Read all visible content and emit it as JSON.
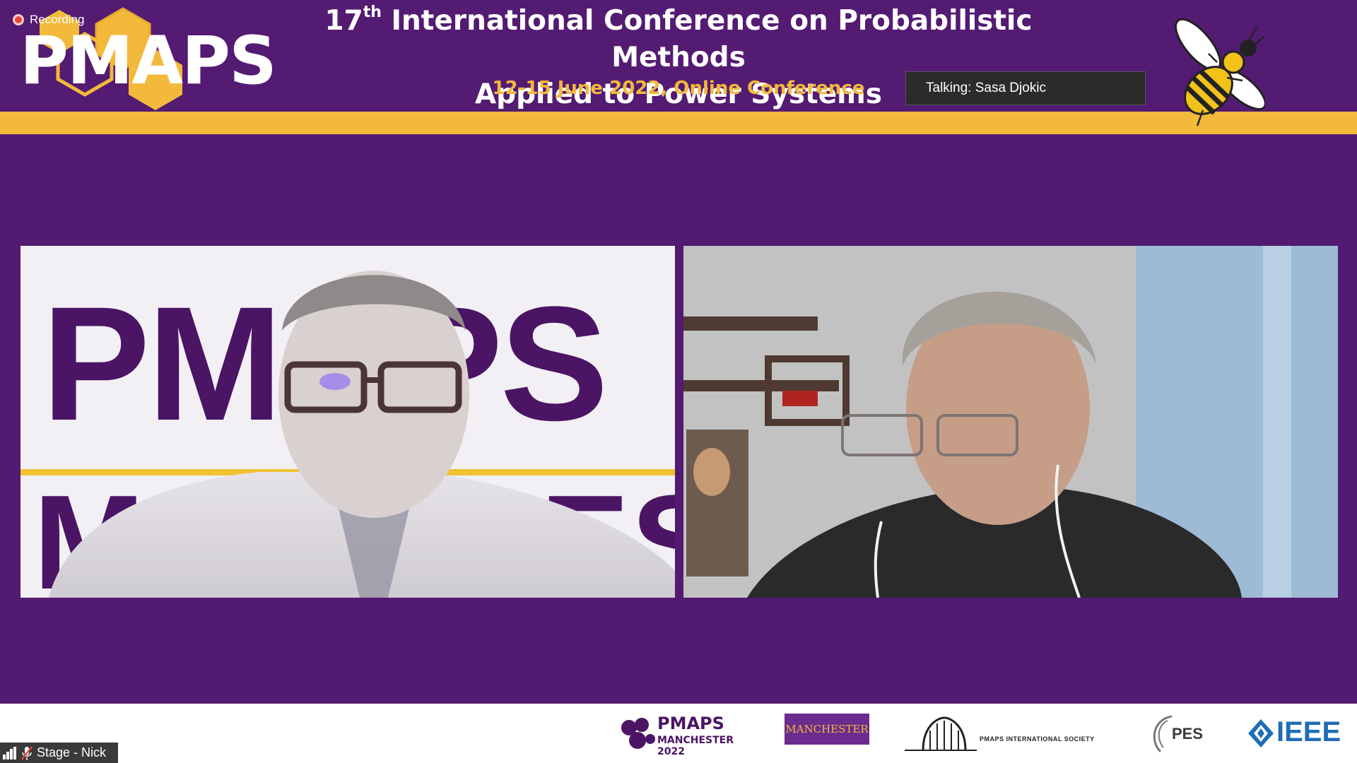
{
  "recording": {
    "label": "Recording"
  },
  "logo": {
    "text": "PMAPS"
  },
  "conference": {
    "title_line1_prefix": "17",
    "title_line1_sup": "th",
    "title_line1_rest": " International Conference on Probabilistic Methods",
    "title_line2": "Applied to Power Systems",
    "subtitle": "12-15 June 2022, Online Conference"
  },
  "talking": {
    "label": "Talking: Sasa Djokic"
  },
  "tiles": {
    "left_backdrop_line1": "PMAPS",
    "left_backdrop_line2": "MANCHESTER"
  },
  "sponsors": {
    "pmaps_title": "PMAPS",
    "pmaps_sub": "MANCHESTER 2022",
    "manchester": "MANCHESTER",
    "society": "PMAPS INTERNATIONAL SOCIETY",
    "pes": "PES",
    "ieee": "IEEE"
  },
  "stage": {
    "label": "Stage - Nick"
  },
  "colors": {
    "background": "#521a70",
    "gold": "#f2b93b",
    "recording_dot": "#e8473e",
    "ieee_blue": "#1f6db4"
  }
}
